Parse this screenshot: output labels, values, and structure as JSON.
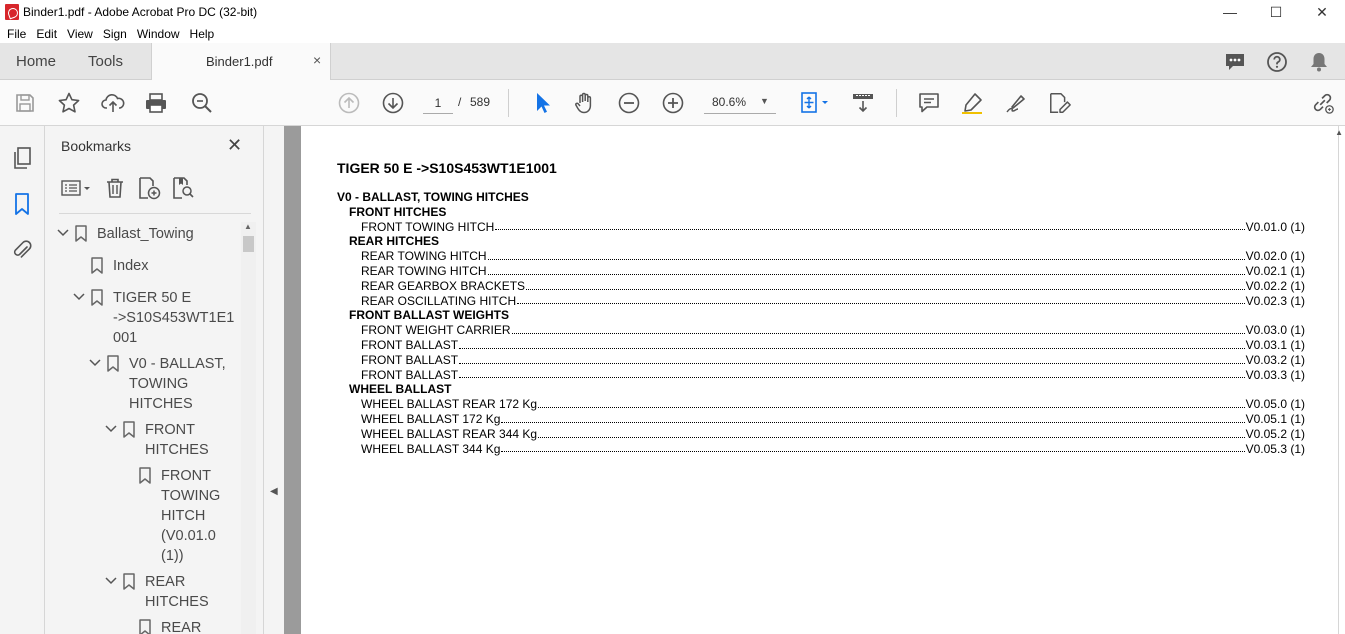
{
  "window": {
    "title": "Binder1.pdf - Adobe Acrobat Pro DC (32-bit)",
    "minimize": "—",
    "maximize": "☐",
    "close": "✕"
  },
  "menu": [
    "File",
    "Edit",
    "View",
    "Sign",
    "Window",
    "Help"
  ],
  "tabs": {
    "home": "Home",
    "tools": "Tools",
    "document": "Binder1.pdf",
    "close": "×"
  },
  "toolbar": {
    "page_current": "1",
    "page_sep": "/",
    "page_total": "589",
    "zoom": "80.6%",
    "zoom_caret": "▼"
  },
  "bookmarks": {
    "title": "Bookmarks",
    "close": "✕",
    "items": [
      {
        "label": "Ballast_Towing",
        "chevron": "⌵"
      },
      {
        "label": "Index",
        "chevron": ""
      },
      {
        "label": "TIGER 50 E\n->S10S453WT1E1\n001",
        "chevron": "⌵"
      },
      {
        "label": "V0 - BALLAST,\nTOWING\nHITCHES",
        "chevron": "⌵"
      },
      {
        "label": "FRONT\nHITCHES",
        "chevron": "⌵"
      },
      {
        "label": "FRONT\nTOWING\nHITCH\n(V0.01.0\n(1))",
        "chevron": ""
      },
      {
        "label": "REAR\nHITCHES",
        "chevron": "⌵"
      },
      {
        "label": "REAR",
        "chevron": ""
      }
    ]
  },
  "document": {
    "title": "TIGER 50 E ->S10S453WT1E1001",
    "section": "V0 - BALLAST, TOWING HITCHES",
    "groups": [
      {
        "heading": "FRONT HITCHES",
        "entries": [
          {
            "name": "FRONT TOWING HITCH",
            "ref": "V0.01.0 (1)"
          }
        ]
      },
      {
        "heading": "REAR HITCHES",
        "entries": [
          {
            "name": "REAR TOWING HITCH",
            "ref": "V0.02.0 (1)"
          },
          {
            "name": "REAR TOWING HITCH",
            "ref": "V0.02.1 (1)"
          },
          {
            "name": "REAR GEARBOX BRACKETS",
            "ref": "V0.02.2 (1)"
          },
          {
            "name": "REAR OSCILLATING HITCH",
            "ref": "V0.02.3 (1)"
          }
        ]
      },
      {
        "heading": "FRONT BALLAST WEIGHTS",
        "entries": [
          {
            "name": "FRONT WEIGHT CARRIER",
            "ref": "V0.03.0 (1)"
          },
          {
            "name": "FRONT BALLAST",
            "ref": "V0.03.1 (1)"
          },
          {
            "name": "FRONT BALLAST",
            "ref": "V0.03.2 (1)"
          },
          {
            "name": "FRONT BALLAST",
            "ref": "V0.03.3 (1)"
          }
        ]
      },
      {
        "heading": "WHEEL BALLAST",
        "entries": [
          {
            "name": "WHEEL BALLAST REAR 172 Kg",
            "ref": "V0.05.0 (1)"
          },
          {
            "name": "WHEEL BALLAST 172 Kg",
            "ref": "V0.05.1 (1)"
          },
          {
            "name": "WHEEL BALLAST REAR 344 Kg",
            "ref": "V0.05.2 (1)"
          },
          {
            "name": "WHEEL BALLAST 344 Kg",
            "ref": "V0.05.3 (1)"
          }
        ]
      }
    ]
  },
  "colors": {
    "accent": "#1473e6",
    "pdf_red": "#d7262b",
    "doc_gutter": "#9b9b9b"
  }
}
